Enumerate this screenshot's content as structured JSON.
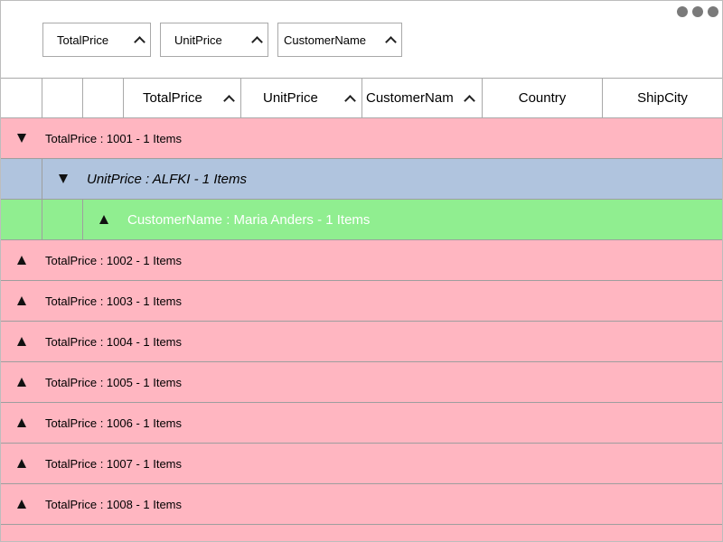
{
  "group_chips": [
    {
      "label": "TotalPrice"
    },
    {
      "label": "UnitPrice"
    },
    {
      "label": "CustomerName"
    }
  ],
  "columns": [
    {
      "label": ""
    },
    {
      "label": ""
    },
    {
      "label": ""
    },
    {
      "label": "TotalPrice"
    },
    {
      "label": "UnitPrice"
    },
    {
      "label": "CustomerNam"
    },
    {
      "label": "Country"
    },
    {
      "label": "ShipCity"
    }
  ],
  "rows": [
    {
      "level": 1,
      "expanded": true,
      "text": "TotalPrice : 1001 - 1 Items"
    },
    {
      "level": 2,
      "expanded": true,
      "text": "UnitPrice : ALFKI - 1 Items"
    },
    {
      "level": 3,
      "expanded": false,
      "text": "CustomerName : Maria Anders - 1 Items"
    },
    {
      "level": 1,
      "expanded": false,
      "text": "TotalPrice : 1002 - 1 Items"
    },
    {
      "level": 1,
      "expanded": false,
      "text": "TotalPrice : 1003 - 1 Items"
    },
    {
      "level": 1,
      "expanded": false,
      "text": "TotalPrice : 1004 - 1 Items"
    },
    {
      "level": 1,
      "expanded": false,
      "text": "TotalPrice : 1005 - 1 Items"
    },
    {
      "level": 1,
      "expanded": false,
      "text": "TotalPrice : 1006 - 1 Items"
    },
    {
      "level": 1,
      "expanded": false,
      "text": "TotalPrice : 1007 - 1 Items"
    },
    {
      "level": 1,
      "expanded": false,
      "text": "TotalPrice : 1008 - 1 Items"
    }
  ],
  "colors": {
    "level1": "#ffb6c1",
    "level2": "#b0c4de",
    "level3": "#90ee90"
  },
  "icons": {
    "expanded": "triangle-down-icon",
    "collapsed": "triangle-up-icon",
    "sort": "caret-up-icon",
    "menu": "more-dots-icon"
  }
}
